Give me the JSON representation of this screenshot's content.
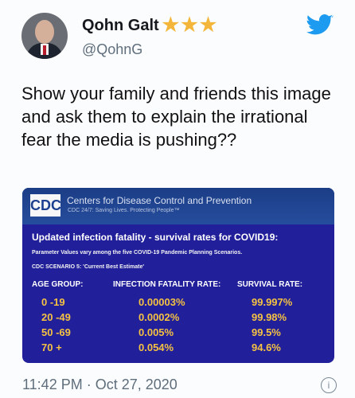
{
  "tweet": {
    "author_name": "Qohn Galt",
    "author_stars": "★★★",
    "handle": "@QohnG",
    "text": "Show your family and friends this image and ask them to explain the irrational fear the media is pushing??",
    "timestamp": "11:42 PM · Oct 27, 2020",
    "info_icon": "i"
  },
  "embed": {
    "logo": "CDC",
    "org_name": "Centers for Disease Control and Prevention",
    "org_tagline": "CDC 24/7: Saving Lives. Protecting People™",
    "title": "Updated infection fatality - survival rates for COVID19:",
    "subtitle": "Parameter Values vary among the five COVID-19 Pandemic Planning Scenarios.",
    "scenario": "CDC SCENARIO 5: 'Current Best Estimate'",
    "headers": [
      "AGE GROUP:",
      "INFECTION FATALITY RATE:",
      "SURVIVAL RATE:"
    ],
    "rows": [
      {
        "age": "0 -19",
        "ifr": "0.00003%",
        "survival": "99.997%"
      },
      {
        "age": "20 -49",
        "ifr": "0.0002%",
        "survival": "99.98%"
      },
      {
        "age": "50 -69",
        "ifr": "0.005%",
        "survival": "99.5%"
      },
      {
        "age": "70 +",
        "ifr": "0.054%",
        "survival": "94.6%"
      }
    ]
  },
  "colors": {
    "brand_twitter": "#1d9bf0",
    "star": "#f3b63a",
    "table_value": "#f5c242",
    "embed_bg": "#211f9a"
  }
}
